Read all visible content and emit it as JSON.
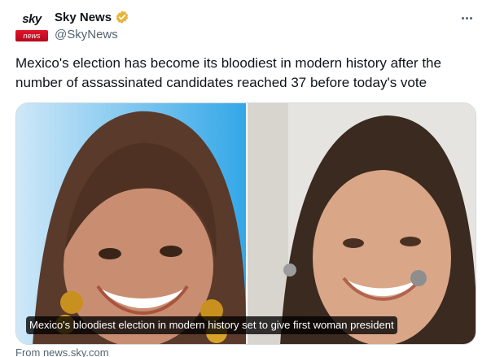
{
  "account": {
    "display_name": "Sky News",
    "handle": "@SkyNews",
    "verified": true,
    "avatar": {
      "logo_word": "sky",
      "logo_sub": "news",
      "icon": "sky-news-logo"
    }
  },
  "menu": {
    "icon": "more-horizontal-icon"
  },
  "tweet": {
    "text": "Mexico's election has become its bloodiest in modern history after the number of assassinated candidates reached 37 before today's vote"
  },
  "card": {
    "caption": "Mexico's bloodiest election in modern history set to give first woman president",
    "source": "From news.sky.com",
    "images": [
      "candidate-photo-left",
      "candidate-photo-right"
    ]
  },
  "colors": {
    "text": "#0f1419",
    "secondary_text": "#536471",
    "verified_badge": "#e8b339",
    "sky_red": "#e3142c",
    "border": "#cfd9de"
  }
}
